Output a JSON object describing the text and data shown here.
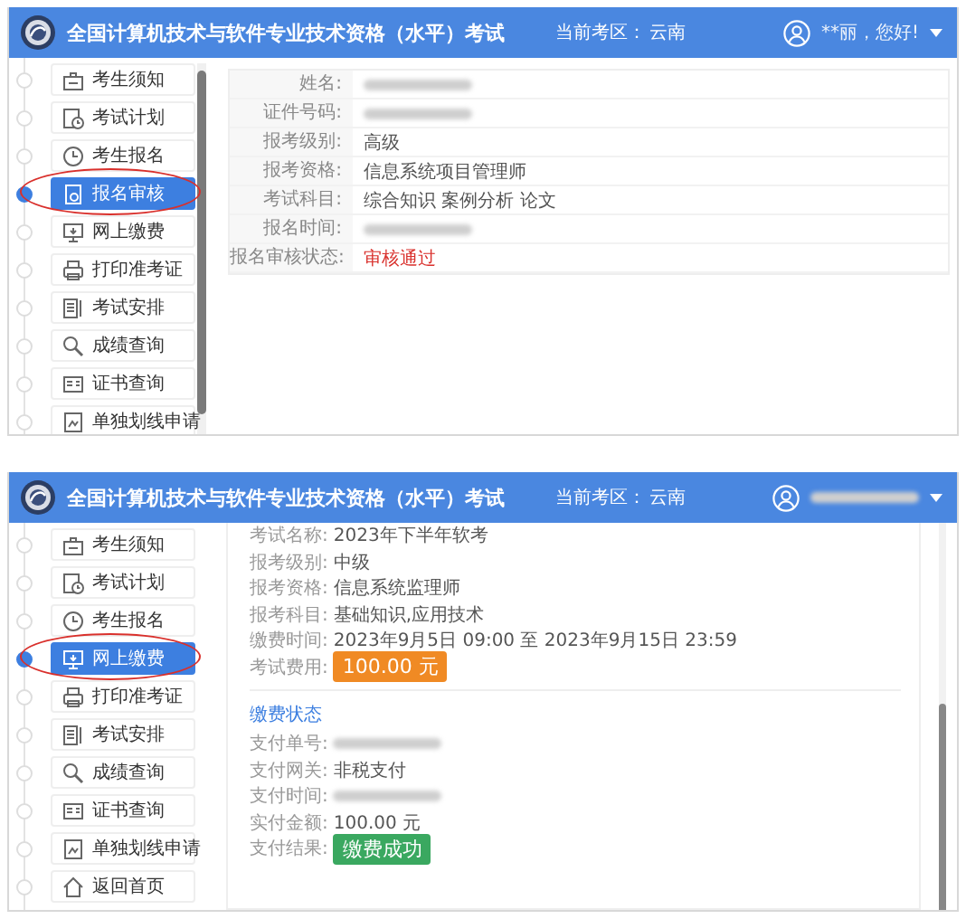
{
  "panels": [
    {
      "header": {
        "title": "全国计算机技术与软件专业技术资格（水平）考试",
        "region_label": "当前考区：",
        "region": "云南",
        "user": {
          "kind": "text",
          "text": "**丽，您好!"
        }
      },
      "sidebar": {
        "items": [
          {
            "kind": "notice",
            "label": "考生须知",
            "selected": false,
            "circled": false
          },
          {
            "kind": "plan",
            "label": "考试计划",
            "selected": false,
            "circled": false
          },
          {
            "kind": "signup",
            "label": "考生报名",
            "selected": false,
            "circled": false
          },
          {
            "kind": "review",
            "label": "报名审核",
            "selected": true,
            "circled": true
          },
          {
            "kind": "payment",
            "label": "网上缴费",
            "selected": false,
            "circled": false
          },
          {
            "kind": "print",
            "label": "打印准考证",
            "selected": false,
            "circled": false
          },
          {
            "kind": "schedule",
            "label": "考试安排",
            "selected": false,
            "circled": false
          },
          {
            "kind": "score",
            "label": "成绩查询",
            "selected": false,
            "circled": false
          },
          {
            "kind": "certificate",
            "label": "证书查询",
            "selected": false,
            "circled": false
          },
          {
            "kind": "application",
            "label": "单独划线申请",
            "selected": false,
            "circled": false
          }
        ]
      },
      "content": {
        "kind": "table",
        "rows": [
          {
            "label": "姓名:",
            "kind": "redacted"
          },
          {
            "label": "证件号码:",
            "kind": "redacted"
          },
          {
            "label": "报考级别:",
            "kind": "text",
            "value": "高级"
          },
          {
            "label": "报考资格:",
            "kind": "text",
            "value": "信息系统项目管理师"
          },
          {
            "label": "考试科目:",
            "kind": "text",
            "value": "综合知识 案例分析 论文"
          },
          {
            "label": "报名时间:",
            "kind": "redacted"
          },
          {
            "label": "报名审核状态:",
            "kind": "status",
            "value": "审核通过"
          }
        ]
      }
    },
    {
      "header": {
        "title": "全国计算机技术与软件专业技术资格（水平）考试",
        "region_label": "当前考区：",
        "region": "云南",
        "user": {
          "kind": "redacted"
        }
      },
      "sidebar": {
        "items": [
          {
            "kind": "notice",
            "label": "考生须知",
            "selected": false,
            "circled": false
          },
          {
            "kind": "plan",
            "label": "考试计划",
            "selected": false,
            "circled": false
          },
          {
            "kind": "signup",
            "label": "考生报名",
            "selected": false,
            "circled": false
          },
          {
            "kind": "payment",
            "label": "网上缴费",
            "selected": true,
            "circled": true
          },
          {
            "kind": "print",
            "label": "打印准考证",
            "selected": false,
            "circled": false
          },
          {
            "kind": "schedule",
            "label": "考试安排",
            "selected": false,
            "circled": false
          },
          {
            "kind": "score",
            "label": "成绩查询",
            "selected": false,
            "circled": false
          },
          {
            "kind": "certificate",
            "label": "证书查询",
            "selected": false,
            "circled": false
          },
          {
            "kind": "application",
            "label": "单独划线申请",
            "selected": false,
            "circled": false
          },
          {
            "kind": "home",
            "label": "返回首页",
            "selected": false,
            "circled": false
          }
        ]
      },
      "content": {
        "kind": "card",
        "rows": [
          {
            "label": "考试名称:",
            "kind": "text",
            "value": "2023年下半年软考"
          },
          {
            "label": "报考级别:",
            "kind": "text",
            "value": "中级"
          },
          {
            "label": "报考资格:",
            "kind": "text",
            "value": "信息系统监理师"
          },
          {
            "label": "报考科目:",
            "kind": "text",
            "value": "基础知识,应用技术"
          },
          {
            "label": "缴费时间:",
            "kind": "text",
            "value": "2023年9月5日 09:00 至 2023年9月15日 23:59"
          },
          {
            "label": "考试费用:",
            "kind": "price",
            "value": "100.00 元"
          }
        ],
        "section_title": "缴费状态",
        "section_rows": [
          {
            "label": "支付单号:",
            "kind": "redacted"
          },
          {
            "label": "支付网关:",
            "kind": "text",
            "value": "非税支付"
          },
          {
            "label": "支付时间:",
            "kind": "redacted"
          },
          {
            "label": "实付金额:",
            "kind": "text",
            "value": "100.00 元"
          },
          {
            "label": "支付结果:",
            "kind": "success",
            "value": "缴费成功"
          }
        ]
      }
    }
  ]
}
